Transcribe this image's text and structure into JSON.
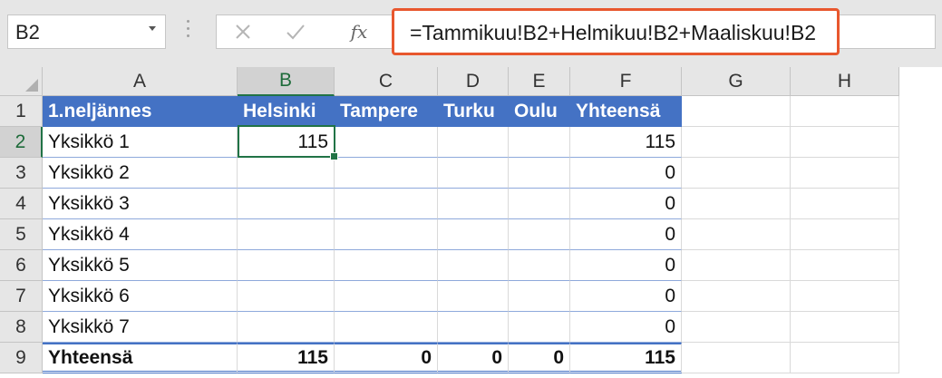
{
  "name_box": {
    "value": "B2"
  },
  "formula_bar": {
    "formula": "=Tammikuu!B2+Helmikuu!B2+Maaliskuu!B2",
    "fx_label": "fx"
  },
  "grid": {
    "columns": [
      "A",
      "B",
      "C",
      "D",
      "E",
      "F",
      "G",
      "H"
    ],
    "rows": [
      "1",
      "2",
      "3",
      "4",
      "5",
      "6",
      "7",
      "8",
      "9"
    ],
    "selected_cell": "B2",
    "header_row": [
      "1.neljännes",
      "Helsinki",
      "Tampere",
      "Turku",
      "Oulu",
      "Yhteensä"
    ],
    "data_rows": [
      [
        "Yksikkö 1",
        "115",
        "",
        "",
        "",
        "115"
      ],
      [
        "Yksikkö 2",
        "",
        "",
        "",
        "",
        "0"
      ],
      [
        "Yksikkö 3",
        "",
        "",
        "",
        "",
        "0"
      ],
      [
        "Yksikkö 4",
        "",
        "",
        "",
        "",
        "0"
      ],
      [
        "Yksikkö 5",
        "",
        "",
        "",
        "",
        "0"
      ],
      [
        "Yksikkö 6",
        "",
        "",
        "",
        "",
        "0"
      ],
      [
        "Yksikkö 7",
        "",
        "",
        "",
        "",
        "0"
      ]
    ],
    "total_row": [
      "Yhteensä",
      "115",
      "0",
      "0",
      "0",
      "115"
    ]
  },
  "colors": {
    "header_fill": "#4472c4",
    "highlight_border": "#e8572e",
    "selection": "#217346"
  }
}
